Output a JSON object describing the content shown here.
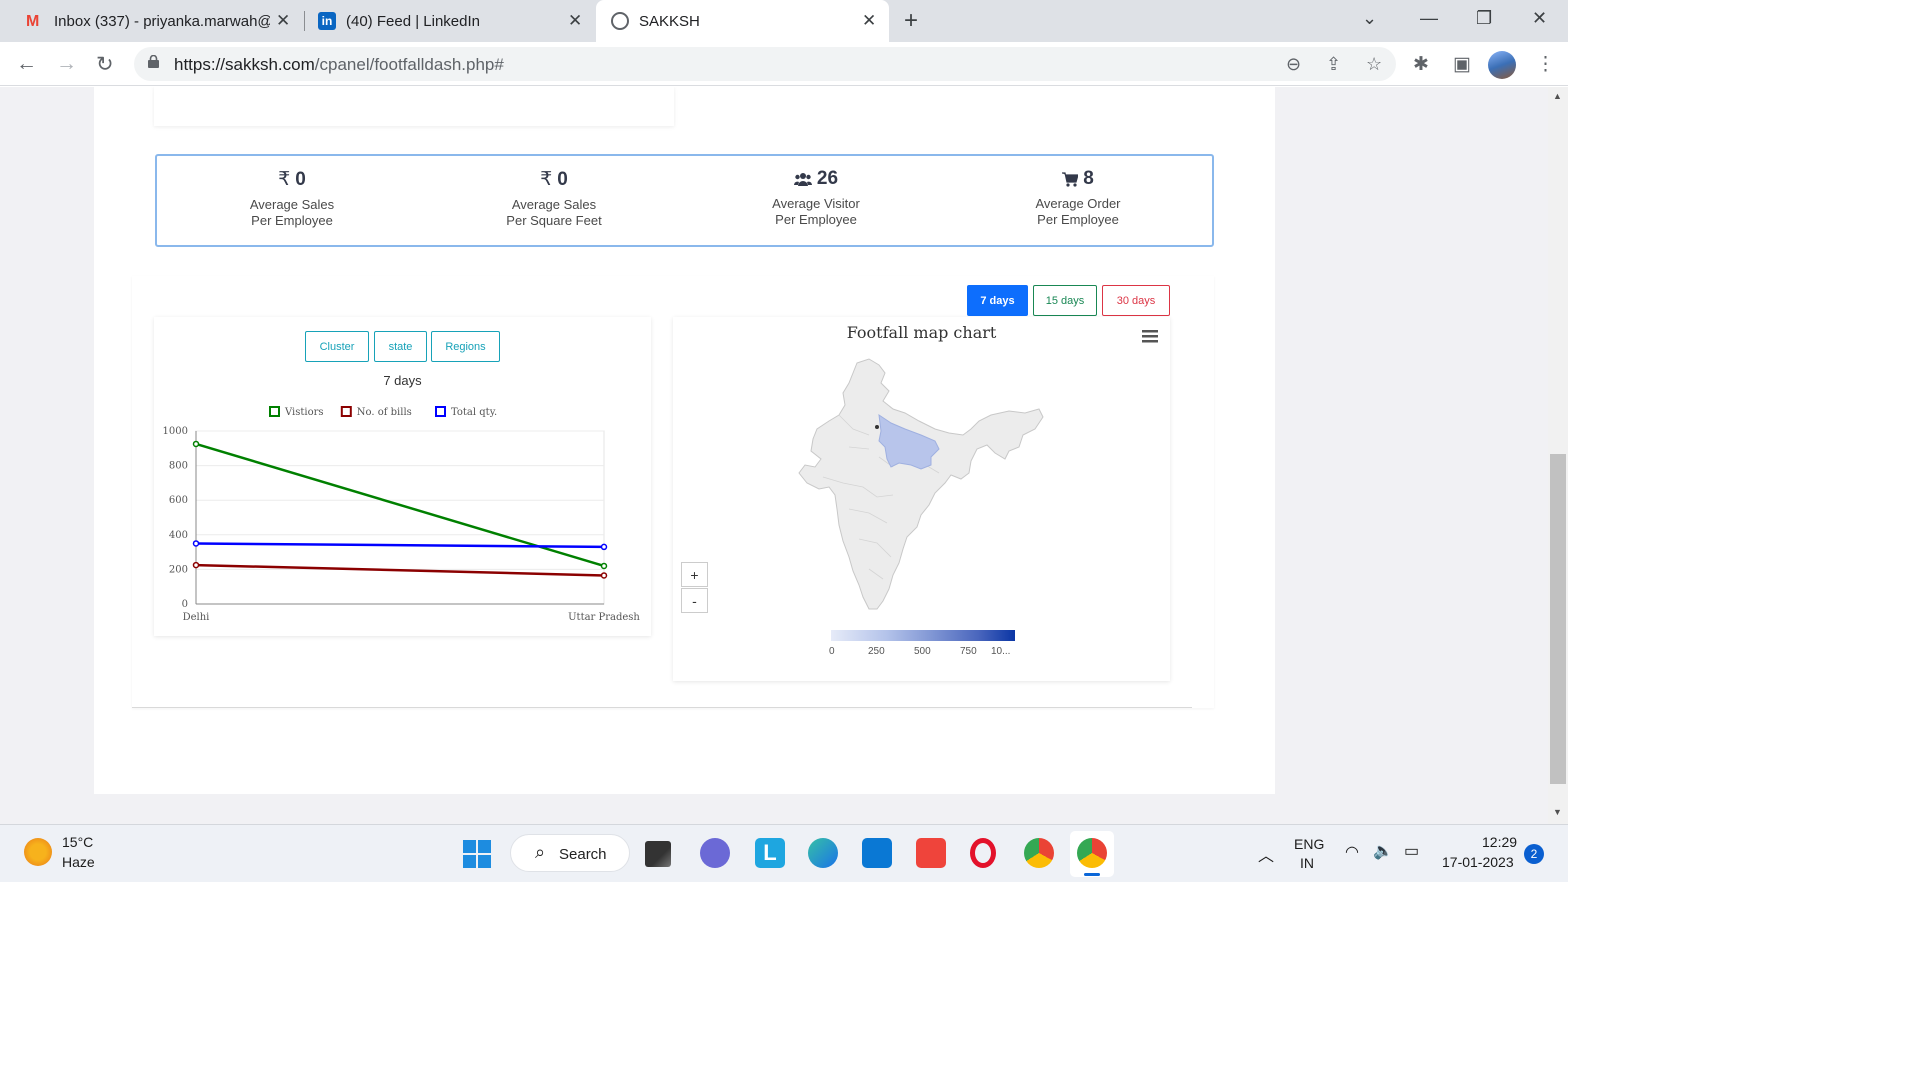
{
  "browser": {
    "tabs": [
      {
        "title": "Inbox (337) - priyanka.marwah@",
        "icon": "gmail-icon"
      },
      {
        "title": "(40) Feed | LinkedIn",
        "icon": "linkedin-icon"
      },
      {
        "title": "SAKKSH",
        "icon": "globe-icon"
      }
    ],
    "url_host": "https://sakksh.com",
    "url_path": "/cpanel/footfalldash.php#"
  },
  "stats": [
    {
      "icon": "rupee-icon",
      "symbol": "₹",
      "value": "0",
      "label1": "Average Sales",
      "label2": "Per Employee"
    },
    {
      "icon": "rupee-icon",
      "symbol": "₹",
      "value": "0",
      "label1": "Average Sales",
      "label2": "Per Square Feet"
    },
    {
      "icon": "users-icon",
      "value": "26",
      "label1": "Average Visitor",
      "label2": "Per Employee"
    },
    {
      "icon": "cart-icon",
      "value": "8",
      "label1": "Average Order",
      "label2": "Per Employee"
    }
  ],
  "period_buttons": {
    "d7": "7 days",
    "d15": "15 days",
    "d30": "30 days",
    "active_color": "#0d6efd",
    "d15_color": "#198754",
    "d30_color": "#dc3545"
  },
  "filters": {
    "cluster": "Cluster",
    "state": "state",
    "regions": "Regions"
  },
  "line_chart_subtitle": "7 days",
  "chart_data": {
    "type": "line",
    "categories": [
      "Delhi",
      "Uttar Pradesh"
    ],
    "series": [
      {
        "name": "Vistiors",
        "color": "#008000",
        "values": [
          925,
          220
        ]
      },
      {
        "name": "No. of bills",
        "color": "#8b0000",
        "values": [
          225,
          165
        ]
      },
      {
        "name": "Total qty.",
        "color": "#0000ff",
        "values": [
          350,
          330
        ]
      }
    ],
    "yticks": [
      "0",
      "200",
      "400",
      "600",
      "800",
      "1000"
    ],
    "ylim": [
      0,
      1000
    ],
    "legend": "top"
  },
  "map": {
    "title": "Footfall map chart",
    "zoom_in": "+",
    "zoom_out": "-",
    "legend_ticks": [
      "0",
      "250",
      "500",
      "750",
      "10..."
    ],
    "highlight_color": "#b8c5eb",
    "scale_colors": [
      "#e6ebf8",
      "#b4c3ea",
      "#8096d4",
      "#4a66bd",
      "#0b36a5"
    ]
  },
  "taskbar": {
    "weather_temp": "15°C",
    "weather_desc": "Haze",
    "search": "Search",
    "lang1": "ENG",
    "lang2": "IN",
    "time": "12:29",
    "date": "17-01-2023",
    "notif_count": "2"
  }
}
